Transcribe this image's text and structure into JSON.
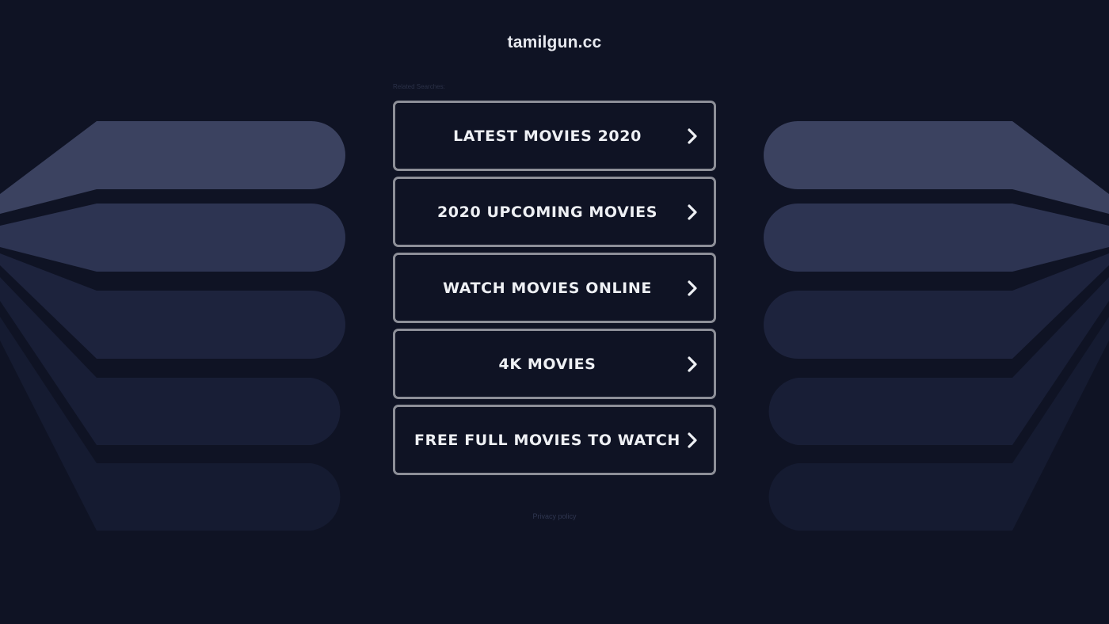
{
  "site": {
    "title": "tamilgun.cc"
  },
  "related": {
    "label": "Related Searches:"
  },
  "links": [
    {
      "label": "LATEST MOVIES 2020"
    },
    {
      "label": "2020 UPCOMING MOVIES"
    },
    {
      "label": "WATCH MOVIES ONLINE"
    },
    {
      "label": "4K MOVIES"
    },
    {
      "label": "FREE FULL MOVIES TO WATCH"
    }
  ],
  "footer": {
    "privacy": "Privacy policy"
  },
  "icons": {
    "link_arrow": "chevron-right-icon"
  },
  "colors": {
    "background": "#0f1324",
    "button_border": "#8d8f98",
    "button_text": "#eef0f4",
    "stripe_1": "#3b4260",
    "stripe_2": "#2d3452",
    "stripe_3": "#1e243e",
    "stripe_4": "#1b2139",
    "stripe_5": "#171d34"
  }
}
